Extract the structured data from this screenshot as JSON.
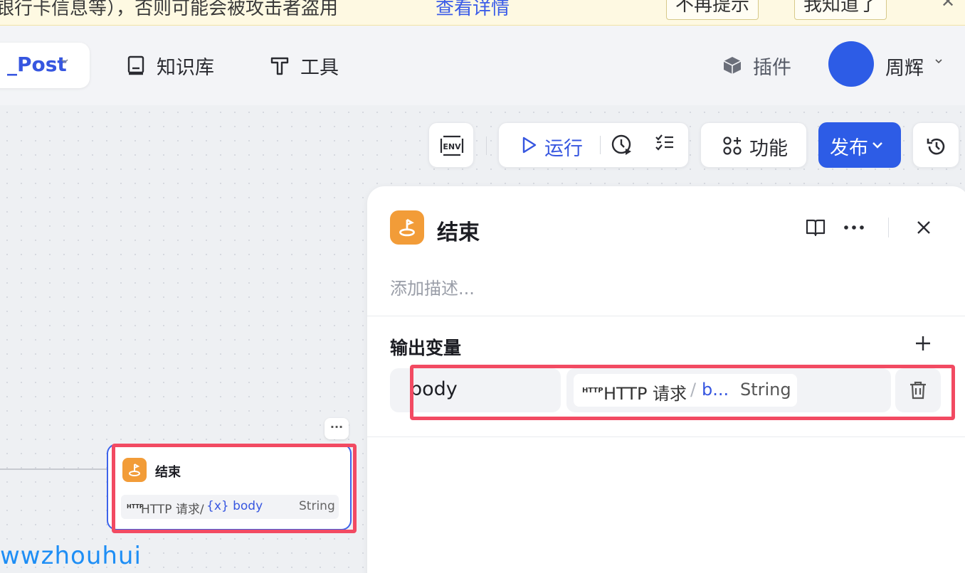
{
  "banner": {
    "text": "银行卡信息等），否则可能会被攻击者盗用",
    "link": "查看详情",
    "dismiss_label": "不再提示",
    "ack_label": "我知道了",
    "close_glyph": "✕"
  },
  "header": {
    "project_name": "_Post",
    "nav": [
      {
        "label": "知识库",
        "icon": "book-icon"
      },
      {
        "label": "工具",
        "icon": "tool-icon"
      }
    ],
    "plugin_label": "插件",
    "user_name": "周辉"
  },
  "toolbar": {
    "env_label": "ENV",
    "run_label": "运行",
    "feature_label": "功能",
    "publish_label": "发布"
  },
  "node": {
    "title": "结束",
    "http_tag": "HTTP",
    "source": "HTTP 请求/",
    "var_icon": "{x}",
    "variable": "body",
    "type": "String",
    "more_glyph": "···"
  },
  "panel": {
    "title": "结束",
    "description_placeholder": "添加描述...",
    "section_title": "输出变量",
    "output": {
      "name": "body",
      "http_tag": "HTTP",
      "source": "HTTP 请求",
      "slash": "/",
      "variable": "b...",
      "type": "String"
    }
  },
  "watermark": "wwzhouhui",
  "colors": {
    "accent": "#2d5ce6",
    "link": "#3656e0",
    "node_icon": "#f29c38",
    "highlight": "#f24a62",
    "banner_bg": "#fef9e2"
  }
}
